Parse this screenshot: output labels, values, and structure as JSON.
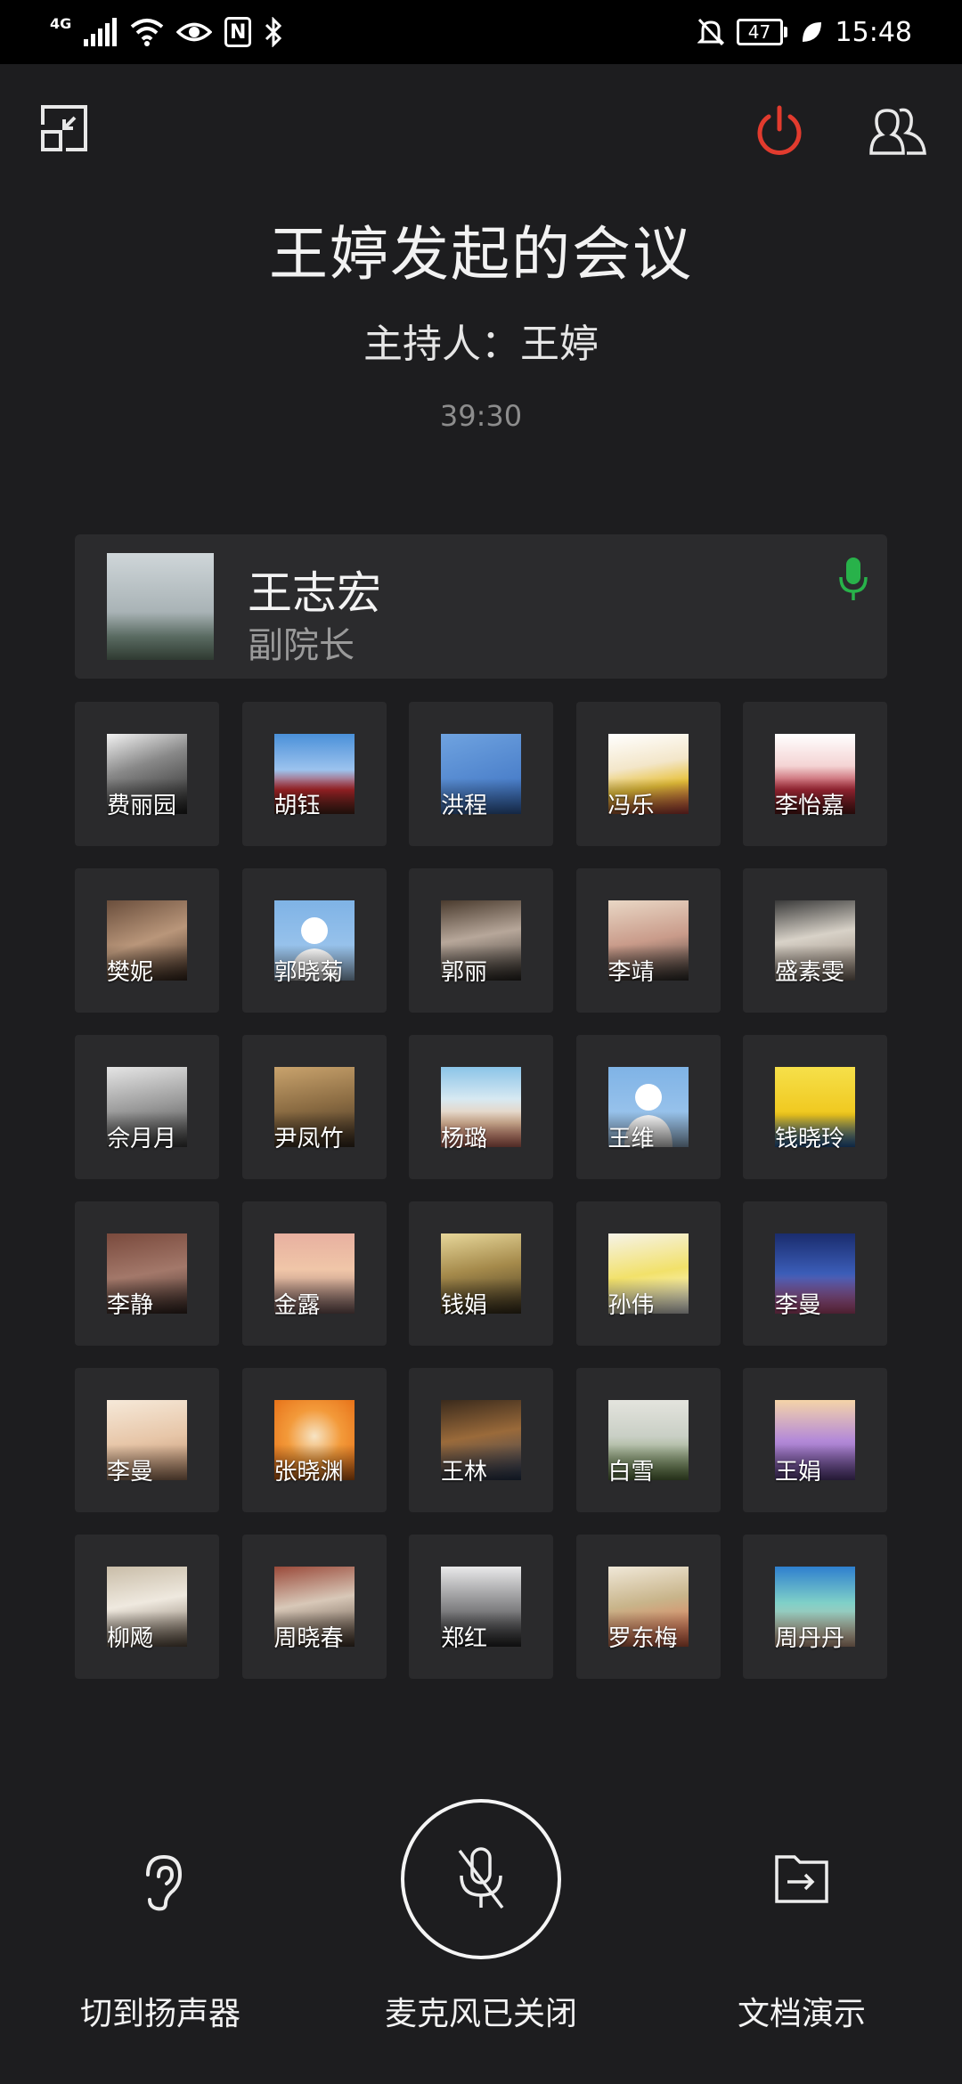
{
  "status_bar": {
    "network": "4G",
    "battery": "47",
    "time": "15:48"
  },
  "meeting": {
    "title": "王婷发起的会议",
    "host": "主持人：王婷",
    "elapsed": "39:30"
  },
  "active_speaker": {
    "name": "王志宏",
    "role": "副院长"
  },
  "participants": [
    {
      "name": "费丽园",
      "bg": "linear-gradient(160deg,#f2f2f2 0%,#888 40%,#222 100%)"
    },
    {
      "name": "胡钰",
      "bg": "linear-gradient(180deg,#4a90d9 0%,#9cc3ee 45%,#b3262a 70%,#5a2b1f 100%)"
    },
    {
      "name": "洪程",
      "bg": "linear-gradient(160deg,#6fa3e0 0%,#3a6fc0 100%)"
    },
    {
      "name": "冯乐",
      "bg": "linear-gradient(170deg,#ffffff 0%,#f3e6c9 40%,#e8c13a 65%,#c44 100%)"
    },
    {
      "name": "李怡嘉",
      "bg": "linear-gradient(180deg,#ffffff 0%,#f4d4d4 40%,#b02a3a 70%,#6e1d1d 100%)"
    },
    {
      "name": "樊妮",
      "bg": "linear-gradient(160deg,#6a4e3c 0%,#b9967a 50%,#3d2b20 100%)"
    },
    {
      "name": "郭晓菊",
      "bg": "default"
    },
    {
      "name": "郭丽",
      "bg": "linear-gradient(170deg,#4a3b2e 0%,#b7a79a 45%,#2e2a26 100%)"
    },
    {
      "name": "李靖",
      "bg": "linear-gradient(170deg,#e9d7c5 0%,#c99b8a 50%,#34322f 100%)"
    },
    {
      "name": "盛素雯",
      "bg": "linear-gradient(170deg,#3a3a3a 0%,#d8d2c8 45%,#8b7b6e 100%)"
    },
    {
      "name": "佘月月",
      "bg": "linear-gradient(170deg,#e5e5e5 0%,#9a9a9a 50%,#444 100%)"
    },
    {
      "name": "尹凤竹",
      "bg": "linear-gradient(170deg,#c9a36d 0%,#8a6b42 50%,#3d2f22 100%)"
    },
    {
      "name": "杨璐",
      "bg": "linear-gradient(180deg,#8bc4e8 0%,#d7e9f2 40%,#f1c9a8 70%,#e57b6b 100%)"
    },
    {
      "name": "王维",
      "bg": "default"
    },
    {
      "name": "钱晓玲",
      "bg": "linear-gradient(180deg,#f6e04a 0%,#f0c81e 60%,#2a6fbf 100%)"
    },
    {
      "name": "李静",
      "bg": "linear-gradient(170deg,#7a4a3d 0%,#a3786a 50%,#3a2a26 100%)"
    },
    {
      "name": "金露",
      "bg": "linear-gradient(180deg,#e8b0a0 0%,#f0c6a8 45%,#8a6a6a 100%)"
    },
    {
      "name": "钱娟",
      "bg": "linear-gradient(170deg,#e7d79a 0%,#a58a4b 45%,#3e3420 100%)"
    },
    {
      "name": "孙伟",
      "bg": "linear-gradient(170deg,#f6f3e8 0%,#f2e16a 50%,#ffffff 100%)"
    },
    {
      "name": "李曼",
      "bg": "linear-gradient(180deg,#1a2c6d 0%,#3b5db8 50%,#d85a8a 100%)"
    },
    {
      "name": "李曼",
      "bg": "linear-gradient(170deg,#f6e9d9 0%,#e7c6a8 50%,#b98a6a 100%)"
    },
    {
      "name": "张晓渊",
      "bg": "radial-gradient(circle at 50% 45%,#f6e4c4 0%,#f39a3a 45%,#e56a12 100%)"
    },
    {
      "name": "王林",
      "bg": "linear-gradient(170deg,#3a2a1c 0%,#9a6a3a 45%,#2b3d5c 100%)"
    },
    {
      "name": "白雪",
      "bg": "linear-gradient(180deg,#e4e4de 0%,#c9cfc5 45%,#6b8a4a 100%)"
    },
    {
      "name": "王娟",
      "bg": "linear-gradient(180deg,#f5d4a8 0%,#b48ad8 50%,#6a4a98 100%)"
    },
    {
      "name": "柳飏",
      "bg": "linear-gradient(170deg,#c9bda8 0%,#efe9df 45%,#6a5a4a 100%)"
    },
    {
      "name": "周晓春",
      "bg": "linear-gradient(170deg,#9a4a3a 0%,#d8c8b8 45%,#4a3a2e 100%)"
    },
    {
      "name": "郑红",
      "bg": "linear-gradient(180deg,#e9e9ea 0%,#9a9a9c 40%,#2a2a2c 100%)"
    },
    {
      "name": "罗东梅",
      "bg": "linear-gradient(170deg,#f0e8d8 0%,#c8b48a 45%,#e86a4a 100%)"
    },
    {
      "name": "周丹丹",
      "bg": "linear-gradient(180deg,#2e7fcf 0%,#7fd0c8 45%,#e8bda0 100%)"
    }
  ],
  "controls": {
    "speaker_label": "切到扬声器",
    "mic_label": "麦克风已关闭",
    "doc_label": "文档演示"
  },
  "colors": {
    "background": "#1d1d1f",
    "card": "#2a2a2c",
    "power_red": "#e23b2e",
    "mic_green": "#28b24a"
  },
  "icons": {
    "top_left": "exit-fullscreen-icon",
    "top_right_1": "power-icon",
    "top_right_2": "members-icon",
    "speaker_status": "microphone-icon",
    "bottom_left": "ear-icon",
    "bottom_center": "mic-off-icon",
    "bottom_right": "share-document-icon"
  }
}
